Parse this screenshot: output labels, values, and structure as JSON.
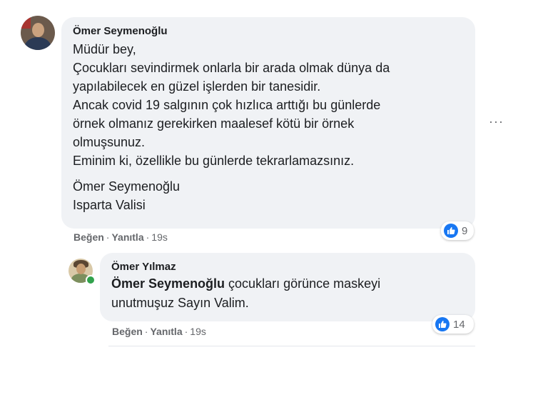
{
  "comment": {
    "author": "Ömer Seymenoğlu",
    "lines": [
      "Müdür bey,",
      "Çocukları sevindirmek onlarla bir arada olmak dünya da",
      "yapılabilecek en güzel işlerden bir tanesidir.",
      "Ancak covid 19 salgının çok hızlıca arttığı bu günlerde",
      "örnek olmanız gerekirken maalesef kötü bir örnek",
      "olmuşsunuz.",
      "Eminim ki, özellikle bu günlerde tekrarlamazsınız."
    ],
    "signature": [
      "Ömer Seymenoğlu",
      "Isparta Valisi"
    ],
    "actions": {
      "like": "Beğen",
      "reply": "Yanıtla",
      "time": "19s"
    },
    "reaction_count": "9",
    "more_label": "···"
  },
  "reply": {
    "author": "Ömer Yılmaz",
    "mention": "Ömer Seymenoğlu",
    "text_line1": " çocukları görünce maskeyi",
    "text_line2": "unutmuşuz Sayın Valim.",
    "actions": {
      "like": "Beğen",
      "reply": "Yanıtla",
      "time": "19s"
    },
    "reaction_count": "14"
  },
  "colors": {
    "bubble": "#f0f2f5",
    "like_blue": "#1877f2",
    "meta": "#65676b",
    "online": "#31a24c"
  }
}
